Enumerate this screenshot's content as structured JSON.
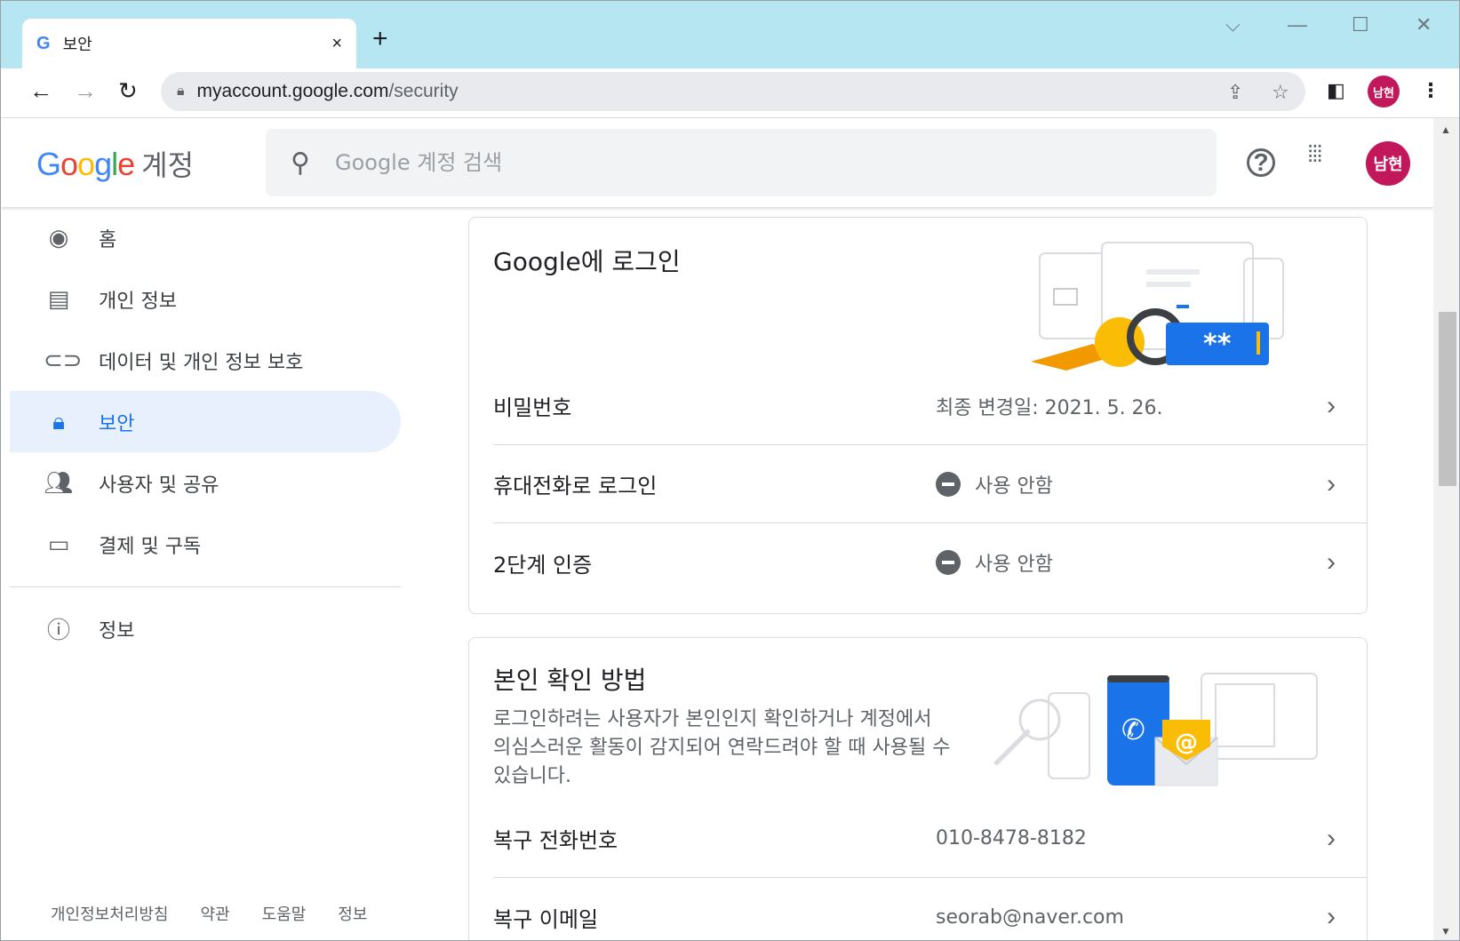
{
  "browser": {
    "tab_title": "보안",
    "tab_favicon": "G",
    "close_tab_glyph": "×",
    "new_tab_glyph": "+",
    "url_host": "myaccount.google.com",
    "url_path": "/security",
    "profile_initials": "남현"
  },
  "header": {
    "logo_word": "Google",
    "logo_suffix": "계정",
    "search_placeholder": "Google 계정 검색",
    "avatar_initials": "남현"
  },
  "sidebar": {
    "items": [
      {
        "label": "홈",
        "icon": "account-circle-icon"
      },
      {
        "label": "개인 정보",
        "icon": "id-card-icon"
      },
      {
        "label": "데이터 및 개인 정보 보호",
        "icon": "toggle-icon"
      },
      {
        "label": "보안",
        "icon": "lock-icon",
        "active": true
      },
      {
        "label": "사용자 및 공유",
        "icon": "people-icon"
      },
      {
        "label": "결제 및 구독",
        "icon": "credit-card-icon"
      }
    ],
    "info_item": {
      "label": "정보",
      "icon": "info-icon"
    }
  },
  "footer": {
    "links": [
      "개인정보처리방침",
      "약관",
      "도움말",
      "정보"
    ]
  },
  "signin_card": {
    "title": "Google에 로그인",
    "rows": [
      {
        "label": "비밀번호",
        "value": "최종 변경일: 2021. 5. 26.",
        "status_icon": false
      },
      {
        "label": "휴대전화로 로그인",
        "value": "사용 안함",
        "status_icon": true
      },
      {
        "label": "2단계 인증",
        "value": "사용 안함",
        "status_icon": true
      }
    ]
  },
  "verify_card": {
    "title": "본인 확인 방법",
    "description": "로그인하려는 사용자가 본인인지 확인하거나 계정에서 의심스러운 활동이 감지되어 연락드려야 할 때 사용될 수 있습니다.",
    "rows": [
      {
        "label": "복구 전화번호",
        "value": "010-8478-8182"
      },
      {
        "label": "복구 이메일",
        "value": "seorab@naver.com"
      }
    ]
  },
  "colors": {
    "tabstrip": "#b6e6f2",
    "accent": "#1a73e8",
    "active_nav_bg": "#e8f0fe",
    "avatar": "#c2185b"
  }
}
